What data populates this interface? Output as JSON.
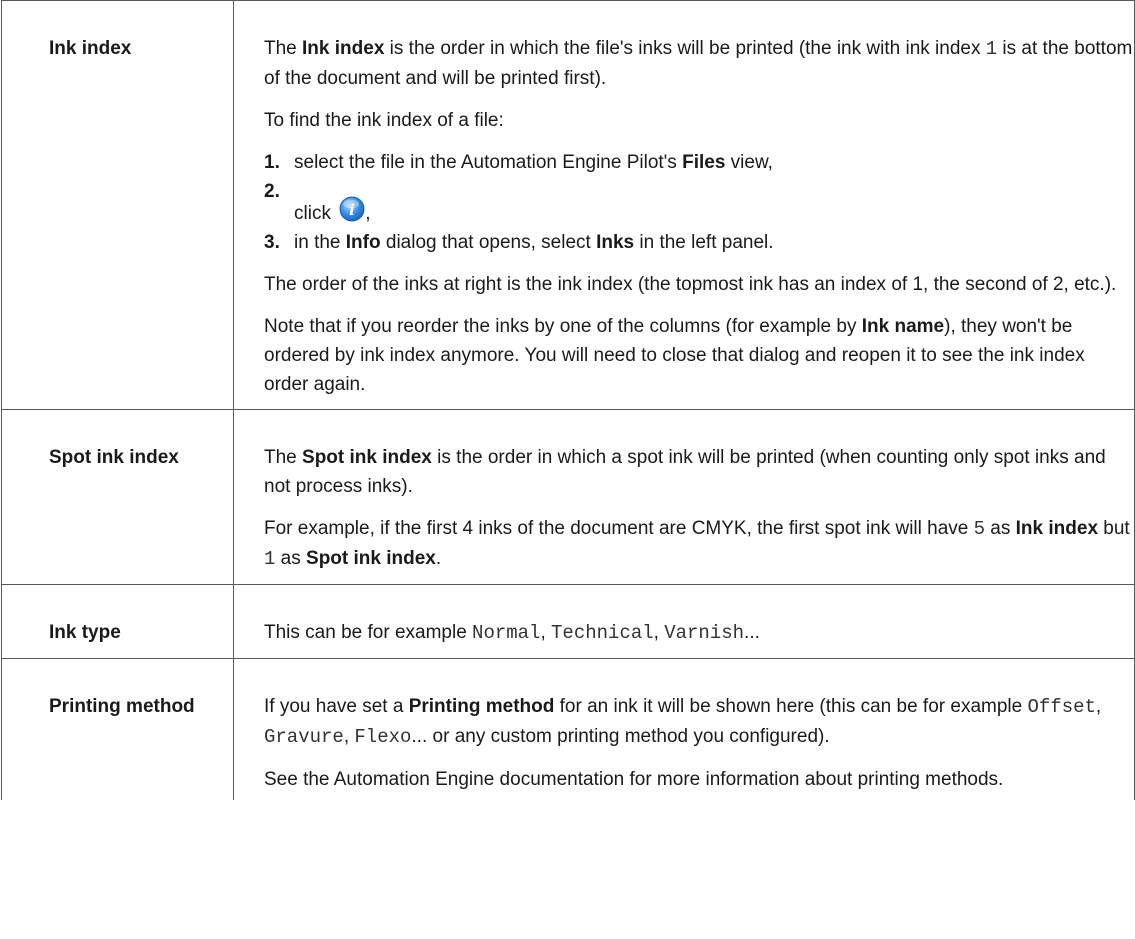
{
  "rows": [
    {
      "term": "Ink index",
      "p1": [
        "The ",
        "Ink index",
        " is the order in which the file's inks will be printed (the ink with ink index ",
        "1",
        " is at the bottom of the document and will be printed first)."
      ],
      "p2": "To find the ink index of a file:",
      "steps": [
        {
          "num": "1.",
          "parts": [
            "select the file in the Automation Engine Pilot's ",
            "Files",
            " view,"
          ]
        },
        {
          "num": "2.",
          "parts": [
            "click ",
            ","
          ],
          "icon": "info-icon"
        },
        {
          "num": "3.",
          "parts": [
            "in the ",
            "Info",
            " dialog that opens, select ",
            "Inks",
            " in the left panel."
          ]
        }
      ],
      "p3": "The order of the inks at right is the ink index (the topmost ink has an index of 1, the second of 2, etc.).",
      "p4": [
        "Note that if you reorder the inks by one of the columns (for example by ",
        "Ink name",
        "), they won't be ordered by ink index anymore. You will need to close that dialog and reopen it to see the ink index order again."
      ]
    },
    {
      "term": "Spot ink index",
      "p1": [
        "The ",
        "Spot ink index",
        " is the order in which a spot ink will be printed (when counting only spot inks and not process inks)."
      ],
      "p2": [
        "For example, if the first 4 inks of the document are CMYK, the first spot ink will have ",
        "5",
        " as ",
        "Ink index",
        " but ",
        "1",
        " as ",
        "Spot ink index",
        "."
      ]
    },
    {
      "term": "Ink type",
      "p1": [
        "This can be for example ",
        "Normal",
        ", ",
        "Technical",
        ", ",
        "Varnish",
        "..."
      ]
    },
    {
      "term": "Printing method",
      "p1": [
        "If you have set a ",
        "Printing method",
        " for an ink it will be shown here (this can be for example ",
        "Offset",
        ", ",
        "Gravure",
        ", ",
        "Flexo",
        "... or any custom printing method you configured)."
      ],
      "p2": "See the Automation Engine documentation for more information about printing methods."
    }
  ],
  "colors": {
    "border": "#5a5a5a",
    "text": "#1a1a1a",
    "icon_blue": "#2f7fd6"
  }
}
